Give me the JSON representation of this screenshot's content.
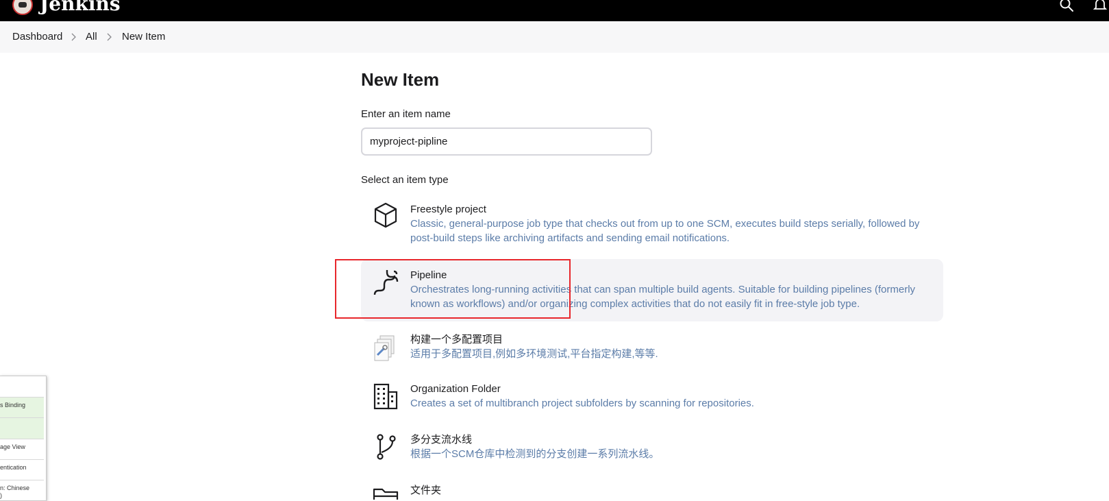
{
  "app": {
    "brand": "Jenkins"
  },
  "breadcrumb": [
    "Dashboard",
    "All",
    "New Item"
  ],
  "page": {
    "title": "New Item",
    "name_label": "Enter an item name",
    "name_value": "myproject-pipline",
    "type_label": "Select an item type"
  },
  "item_types": [
    {
      "title": "Freestyle project",
      "icon": "box-icon",
      "description": "Classic, general-purpose job type that checks out from up to one SCM, executes build steps serially, followed by post-build steps like archiving artifacts and sending email notifications."
    },
    {
      "title": "Pipeline",
      "icon": "pipeline-icon",
      "selected": true,
      "description": "Orchestrates long-running activities that can span multiple build agents. Suitable for building pipelines (formerly known as workflows) and/or organizing complex activities that do not easily fit in free-style job type."
    },
    {
      "title": "构建一个多配置项目",
      "icon": "multi-config-icon",
      "description": "适用于多配置项目,例如多环境测试,平台指定构建,等等."
    },
    {
      "title": "Organization Folder",
      "icon": "building-icon",
      "description": "Creates a set of multibranch project subfolders by scanning for repositories."
    },
    {
      "title": "多分支流水线",
      "icon": "branch-icon",
      "description": "根据一个SCM仓库中检测到的分支创建一系列流水线。"
    },
    {
      "title": "文件夹",
      "icon": "folder-icon",
      "description": ""
    }
  ],
  "side_panel": {
    "items": [
      "s Binding",
      "age View",
      "entication",
      "n: Chinese",
      ")"
    ]
  },
  "colors": {
    "accent_highlight": "#e8262b",
    "desc_text": "#5b7ca8",
    "topbar": "#000000"
  }
}
